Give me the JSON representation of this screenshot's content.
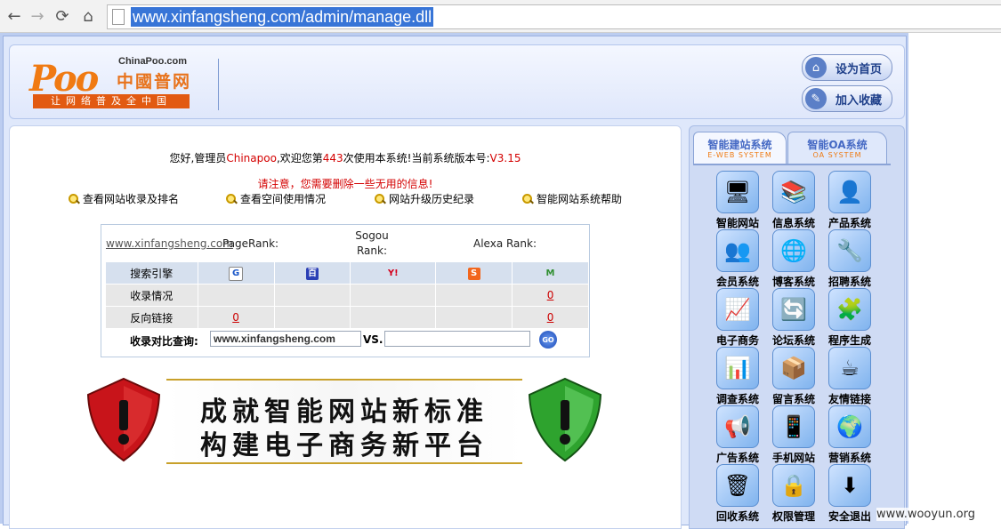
{
  "browser": {
    "url": "www.xinfangsheng.com/admin/manage.dll"
  },
  "header": {
    "logo_text": "Poo",
    "logo_brand": "ChinaPoo.com",
    "logo_cn": "中國普网",
    "logo_slogan": "让网络普及全中国",
    "set_home_label": "设为首页",
    "add_fav_label": "加入收藏"
  },
  "welcome": {
    "pre": "您好,管理员",
    "user": "Chinapoo",
    "mid": ",欢迎您第",
    "count": "443",
    "post": "次使用本系统!当前系统版本号:",
    "version": "V3.15"
  },
  "notice": "请注意，您需要删除一些无用的信息!",
  "quick_links": [
    "查看网站收录及排名",
    "查看空间使用情况",
    "网站升级历史纪录",
    "智能网站系统帮助"
  ],
  "stats": {
    "site": "www.xinfangsheng.com",
    "pagerank_label": "PageRank:",
    "sogou_label_1": "Sogou",
    "sogou_label_2": "Rank:",
    "alexa_label": "Alexa Rank:",
    "row_headers": [
      "搜索引擎",
      "收录情况",
      "反向链接"
    ],
    "engine_icons": [
      "G",
      "百",
      "Y!",
      "S",
      "M"
    ],
    "index_values": [
      "",
      "",
      "",
      "",
      "0"
    ],
    "backlink_values": [
      "0",
      "",
      "",
      "",
      "0"
    ],
    "compare_label": "收录对比查询:",
    "compare_input1": "www.xinfangsheng.com",
    "compare_vs": "VS.",
    "compare_go": "GO"
  },
  "banner": {
    "line1": "成就智能网站新标准",
    "line2": "构建电子商务新平台"
  },
  "right_panel": {
    "tabs": [
      {
        "title": "智能建站系统",
        "sub": "E-WEB SYSTEM"
      },
      {
        "title": "智能OA系统",
        "sub": "OA SYSTEM"
      }
    ],
    "modules": [
      {
        "label": "智能网站",
        "icon": "🖥"
      },
      {
        "label": "信息系统",
        "icon": "📚"
      },
      {
        "label": "产品系统",
        "icon": "👤"
      },
      {
        "label": "会员系统",
        "icon": "👥"
      },
      {
        "label": "博客系统",
        "icon": "🌐"
      },
      {
        "label": "招聘系统",
        "icon": "🔧"
      },
      {
        "label": "电子商务",
        "icon": "📈"
      },
      {
        "label": "论坛系统",
        "icon": "🔄"
      },
      {
        "label": "程序生成",
        "icon": "🧩"
      },
      {
        "label": "调查系统",
        "icon": "📊"
      },
      {
        "label": "留言系统",
        "icon": "📦"
      },
      {
        "label": "友情链接",
        "icon": "☕"
      },
      {
        "label": "广告系统",
        "icon": "📢"
      },
      {
        "label": "手机网站",
        "icon": "📱"
      },
      {
        "label": "营销系统",
        "icon": "🌍"
      },
      {
        "label": "回收系统",
        "icon": "🗑"
      },
      {
        "label": "权限管理",
        "icon": "🔒"
      },
      {
        "label": "安全退出",
        "icon": "⬇"
      }
    ]
  },
  "watermark": "www.wooyun.org"
}
